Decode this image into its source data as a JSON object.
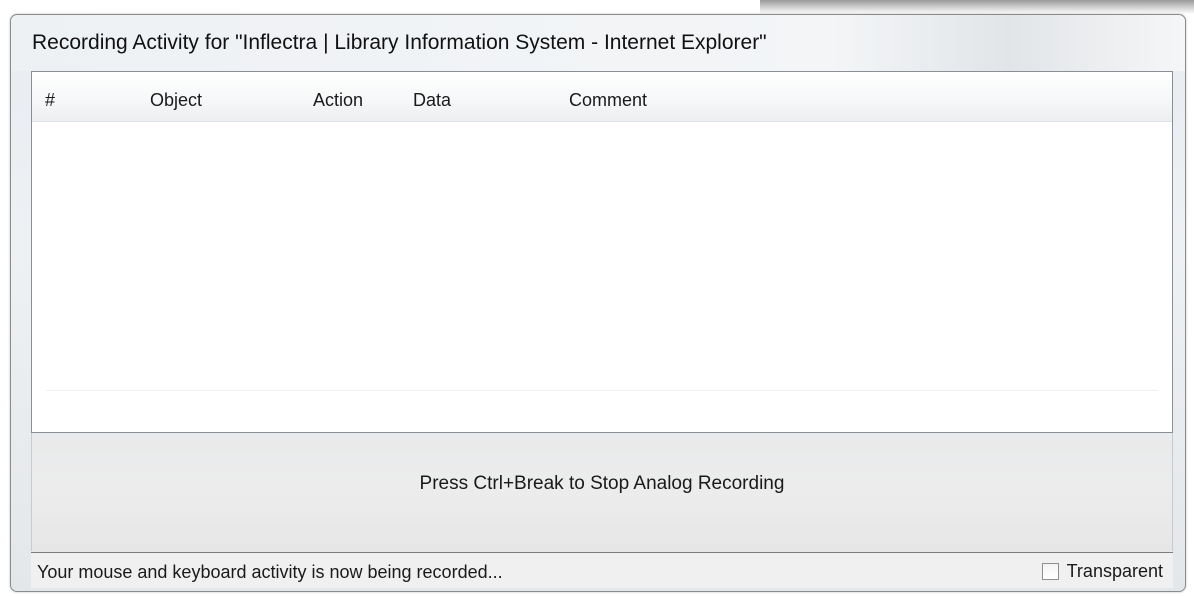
{
  "window": {
    "title": "Recording Activity for \"Inflectra | Library Information System - Internet Explorer\""
  },
  "list": {
    "columns": [
      "#",
      "Object",
      "Action",
      "Data",
      "Comment"
    ],
    "rows": []
  },
  "recording": {
    "message": "Press Ctrl+Break to Stop Analog Recording"
  },
  "status_bar": {
    "text": "Your mouse and keyboard activity is now being recorded...",
    "transparent_label": "Transparent",
    "transparent_checked": false
  },
  "colors": {
    "window_bg": "#eef1f4",
    "list_bg": "#ffffff",
    "status_area_bg": "#e9eaeb",
    "border": "#8a8f96"
  }
}
